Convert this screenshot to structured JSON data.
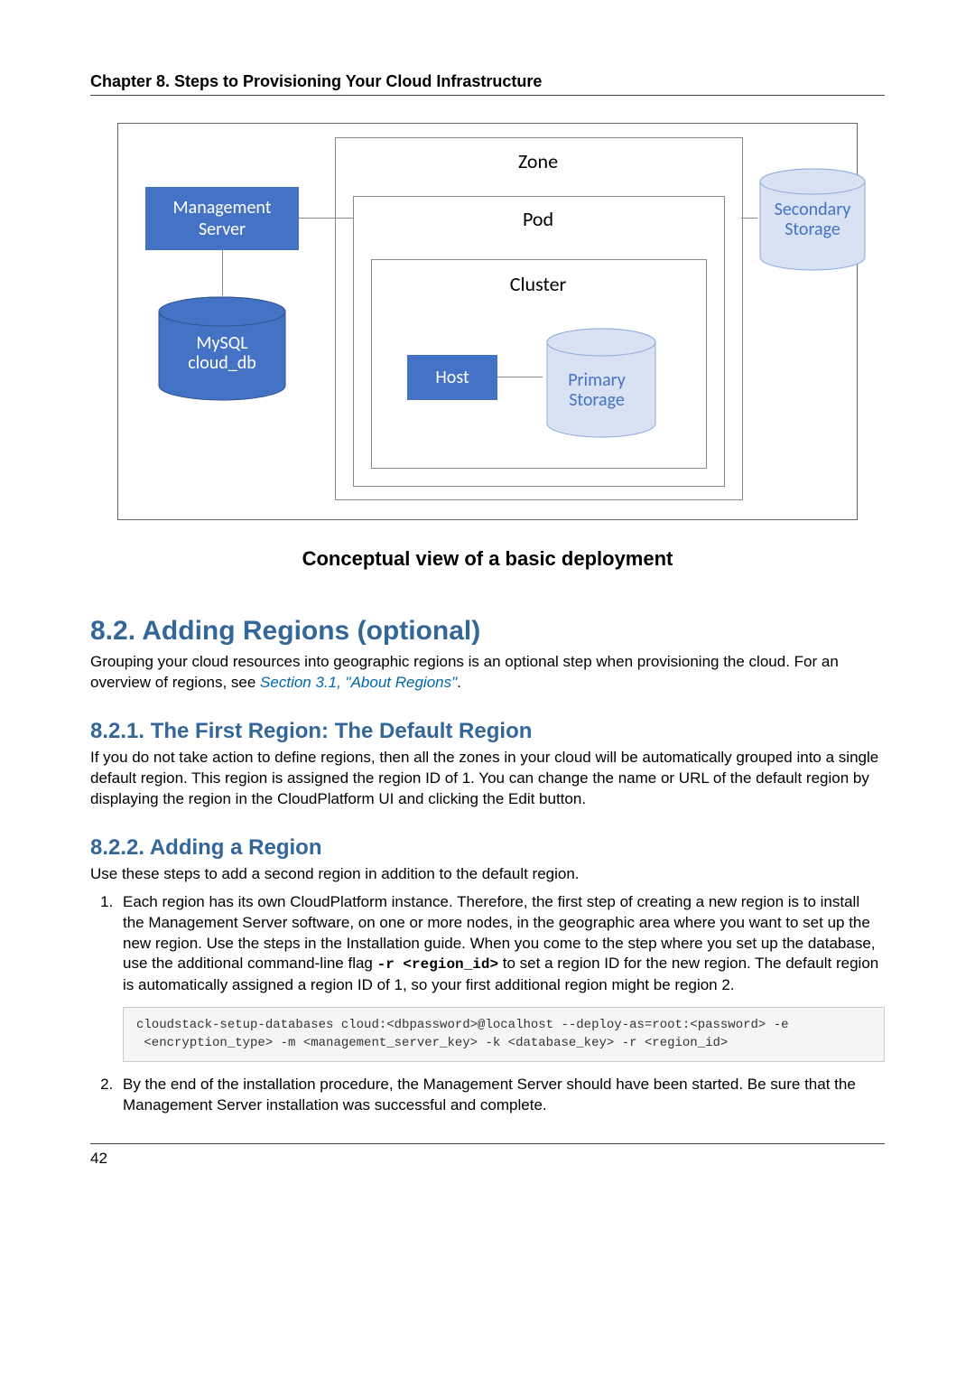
{
  "header": {
    "chapter": "Chapter 8. Steps to Provisioning Your Cloud Infrastructure"
  },
  "diagram": {
    "zone": "Zone",
    "pod": "Pod",
    "cluster": "Cluster",
    "host": "Host",
    "primary_storage": "Primary\nStorage",
    "management_server": "Management\nServer",
    "mysql": "MySQL\ncloud_db",
    "secondary_storage": "Secondary\nStorage",
    "caption": "Conceptual view of a basic deployment"
  },
  "section_8_2": {
    "heading": "8.2. Adding Regions (optional)",
    "p1a": "Grouping your cloud resources into geographic regions is an optional step when provisioning the cloud. For an overview of regions, see ",
    "p1_link": "Section 3.1, \"About Regions\"",
    "p1b": "."
  },
  "section_8_2_1": {
    "heading": "8.2.1. The First Region: The Default Region",
    "p": "If you do not take action to define regions, then all the zones in your cloud will be automatically grouped into a single default region. This region is assigned the region ID of 1. You can change the name or URL of the default region by displaying the region in the CloudPlatform UI and clicking the Edit button."
  },
  "section_8_2_2": {
    "heading": "8.2.2. Adding a Region",
    "intro": "Use these steps to add a second region in addition to the default region.",
    "steps": {
      "s1a": "Each region has its own CloudPlatform instance. Therefore, the first step of creating a new region is to install the Management Server software, on one or more nodes, in the geographic area where you want to set up the new region. Use the steps in the Installation guide. When you come to the step where you set up the database, use the additional command-line flag ",
      "s1_flag": "-r <region_id>",
      "s1b": " to set a region ID for the new region. The default region is automatically assigned a region ID of 1, so your first additional region might be region 2.",
      "s1_code": "cloudstack-setup-databases cloud:<dbpassword>@localhost --deploy-as=root:<password> -e\n <encryption_type> -m <management_server_key> -k <database_key> -r <region_id>",
      "s2": "By the end of the installation procedure, the Management Server should have been started. Be sure that the Management Server installation was successful and complete."
    }
  },
  "footer": {
    "page": "42"
  }
}
